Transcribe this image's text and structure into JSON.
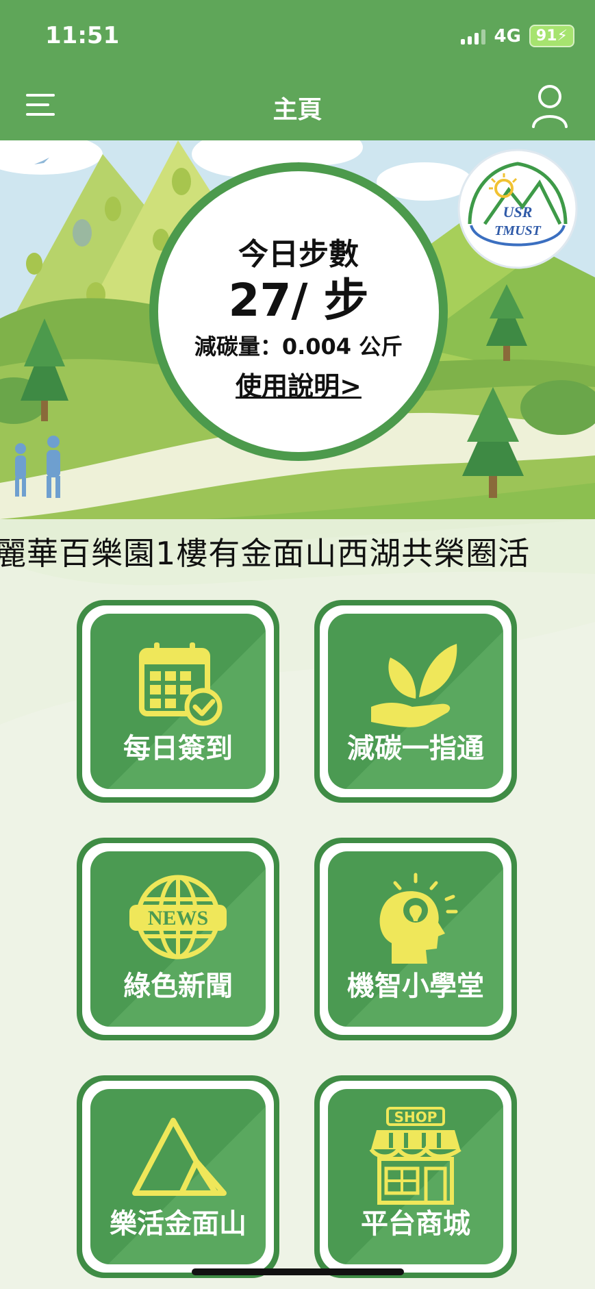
{
  "status_bar": {
    "time": "11:51",
    "network": "4G",
    "battery": "91"
  },
  "nav": {
    "title": "主頁",
    "menu_icon": "hamburger-menu-icon",
    "user_icon": "user-profile-icon"
  },
  "step_card": {
    "label": "今日步數",
    "count": "27/ 步",
    "carbon": "減碳量：0.004 公斤",
    "usage_link": "使用說明>"
  },
  "logo": {
    "line1": "USR",
    "line2": "TMUST"
  },
  "marquee": {
    "text": "麗華百樂園1樓有金面山西湖共榮圈活"
  },
  "tiles": [
    {
      "label": "每日簽到",
      "icon": "calendar-check-icon"
    },
    {
      "label": "減碳一指通",
      "icon": "leaf-hand-icon"
    },
    {
      "label": "綠色新聞",
      "icon": "news-globe-icon"
    },
    {
      "label": "機智小學堂",
      "icon": "head-lightbulb-icon"
    },
    {
      "label": "樂活金面山",
      "icon": "mountain-icon"
    },
    {
      "label": "平台商城",
      "icon": "shop-icon"
    }
  ],
  "icon_text": {
    "news": "NEWS",
    "shop": "SHOP"
  },
  "colors": {
    "primary_green": "#5fa659",
    "tile_green": "#4b9a52",
    "icon_yellow": "#efe75a"
  }
}
